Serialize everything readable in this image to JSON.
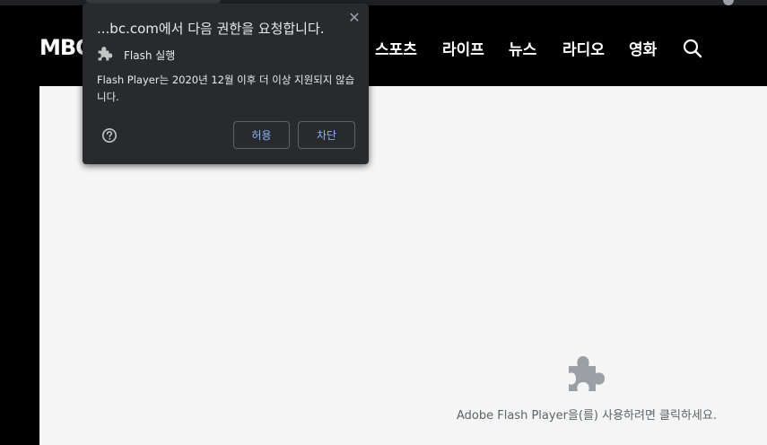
{
  "site": {
    "logo": "MBC",
    "nav_items": [
      "스포츠",
      "라이프",
      "뉴스",
      "라디오",
      "영화"
    ]
  },
  "permission_popup": {
    "title": "...bc.com에서 다음 권한을 요청합니다.",
    "permission_label": "Flash 실행",
    "message": "Flash Player는 2020년 12월 이후 더 이상 지원되지 않습니다.",
    "allow_label": "허용",
    "block_label": "차단",
    "close_glyph": "✕"
  },
  "plugin_placeholder": {
    "text": "Adobe Flash Player을(를) 사용하려면 클릭하세요."
  },
  "colors": {
    "popup_bg": "#292a2d",
    "button_text": "#8ab4f8",
    "content_bg": "#f5f5f5"
  }
}
